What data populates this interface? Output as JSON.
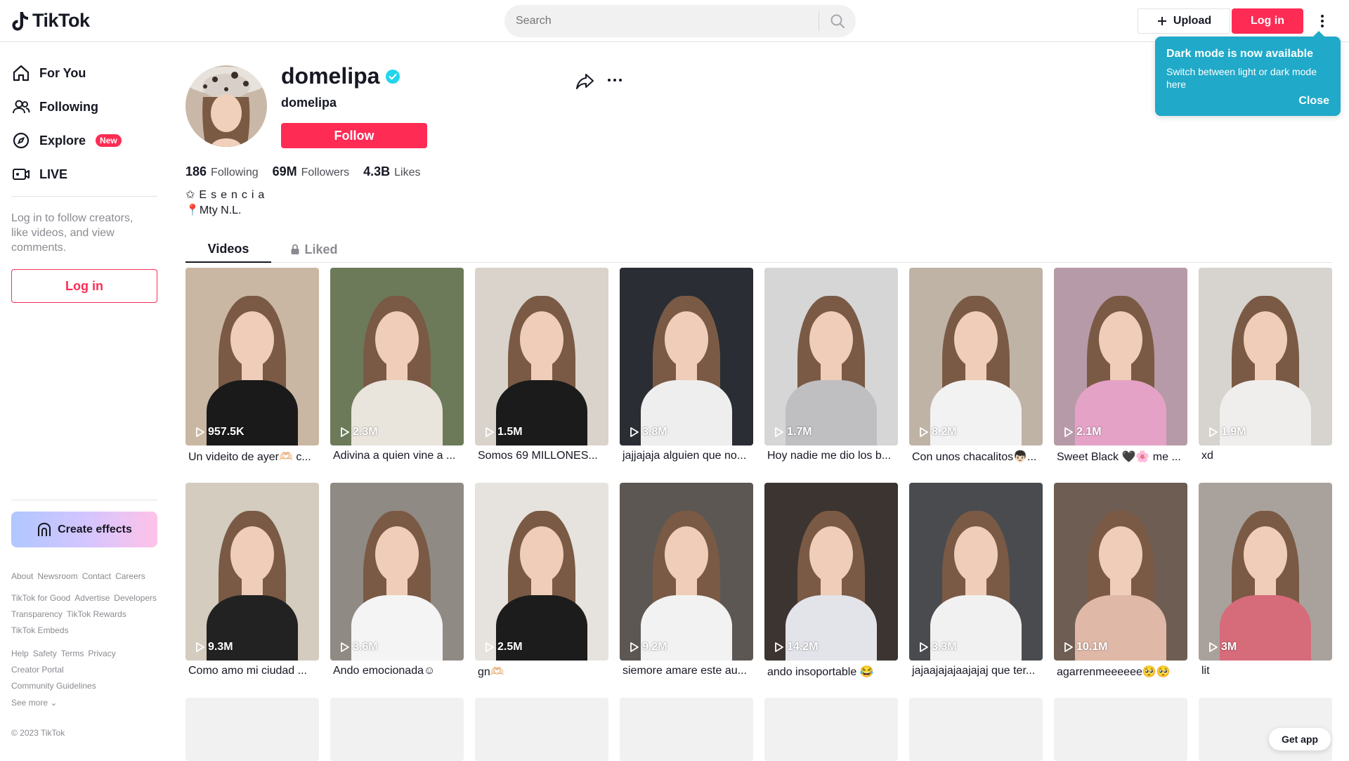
{
  "header": {
    "brand": "TikTok",
    "search_placeholder": "Search",
    "upload_label": "Upload",
    "login_label": "Log in"
  },
  "tooltip": {
    "title": "Dark mode is now available",
    "body": "Switch between light or dark mode here",
    "close": "Close"
  },
  "sidebar": {
    "nav": [
      {
        "label": "For You",
        "icon": "home-icon"
      },
      {
        "label": "Following",
        "icon": "people-icon"
      },
      {
        "label": "Explore",
        "icon": "compass-icon",
        "badge": "New"
      },
      {
        "label": "LIVE",
        "icon": "live-icon"
      }
    ],
    "login_prompt": "Log in to follow creators, like videos, and view comments.",
    "login_button": "Log in",
    "create_effects": "Create effects",
    "footer_groups": [
      [
        "About",
        "Newsroom",
        "Contact",
        "Careers"
      ],
      [
        "TikTok for Good",
        "Advertise",
        "Developers",
        "Transparency",
        "TikTok Rewards",
        "TikTok Embeds"
      ],
      [
        "Help",
        "Safety",
        "Terms",
        "Privacy",
        "Creator Portal",
        "Community Guidelines"
      ]
    ],
    "see_more": "See more",
    "copyright": "© 2023 TikTok"
  },
  "profile": {
    "username": "domelipa",
    "nickname": "domelipa",
    "follow_label": "Follow",
    "stats": [
      {
        "num": "186",
        "label": "Following"
      },
      {
        "num": "69M",
        "label": "Followers"
      },
      {
        "num": "4.3B",
        "label": "Likes"
      }
    ],
    "bio_line1": "✩Esencia",
    "bio_line2": "📍Mty N.L."
  },
  "tabs": {
    "videos": "Videos",
    "liked": "Liked"
  },
  "videos": [
    {
      "views": "957.5K",
      "caption": "Un videito de ayer🫶🏻 c...",
      "bg": "#c9b7a3",
      "shirt": "#1a1a1a"
    },
    {
      "views": "2.3M",
      "caption": "Adivina a quien vine a ...",
      "bg": "#6c7a5a",
      "shirt": "#e9e4dc"
    },
    {
      "views": "1.5M",
      "caption": "Somos 69 MILLONES...",
      "bg": "#d9d3cc",
      "shirt": "#1b1b1b"
    },
    {
      "views": "3.8M",
      "caption": "jajjajaja alguien que no...",
      "bg": "#2a2d33",
      "shirt": "#eeeeee"
    },
    {
      "views": "1.7M",
      "caption": "Hoy nadie me dio los b...",
      "bg": "#d6d6d6",
      "shirt": "#bfbfc2"
    },
    {
      "views": "8.2M",
      "caption": "Con unos chacalitos👦🏻...",
      "bg": "#bfb3a6",
      "shirt": "#f2f2f2"
    },
    {
      "views": "2.1M",
      "caption": "Sweet Black 🖤🌸 me ...",
      "bg": "#b79aa7",
      "shirt": "#e4a3c6"
    },
    {
      "views": "1.9M",
      "caption": "xd",
      "bg": "#d7d3cf",
      "shirt": "#f0eeec"
    },
    {
      "views": "9.3M",
      "caption": "Como amo mi ciudad ...",
      "bg": "#d3ccbf",
      "shirt": "#222222"
    },
    {
      "views": "3.6M",
      "caption": "Ando emocionada☺︎",
      "bg": "#8f8a84",
      "shirt": "#f4f4f4"
    },
    {
      "views": "2.5M",
      "caption": "gn🫶🏻",
      "bg": "#e6e2dd",
      "shirt": "#1c1c1c"
    },
    {
      "views": "9.2M",
      "caption": "siemore amare este au...",
      "bg": "#5d5753",
      "shirt": "#f2f2f2"
    },
    {
      "views": "14.2M",
      "caption": "ando insoportable 😂",
      "bg": "#3c3430",
      "shirt": "#e3e3ea"
    },
    {
      "views": "3.3M",
      "caption": "jajaajajajaajajaj que ter...",
      "bg": "#4a4b4f",
      "shirt": "#f1f1f1"
    },
    {
      "views": "10.1M",
      "caption": "agarrenmeeeeee🥺🥺",
      "bg": "#6e5d52",
      "shirt": "#e0b8a8"
    },
    {
      "views": "3M",
      "caption": "lit",
      "bg": "#a9a29c",
      "shirt": "#d66b7a"
    }
  ],
  "get_app": "Get app"
}
